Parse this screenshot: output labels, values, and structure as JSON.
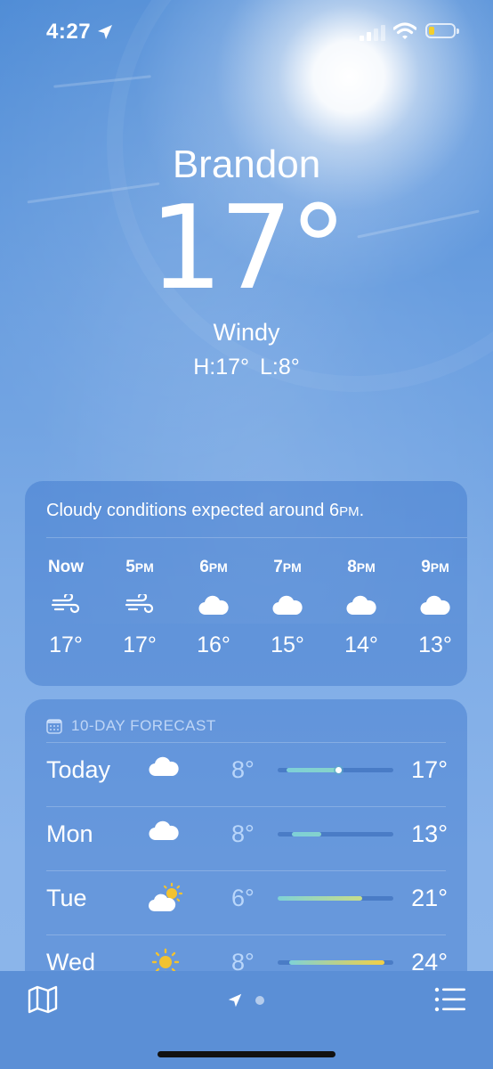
{
  "status_bar": {
    "time": "4:27"
  },
  "header": {
    "city": "Brandon",
    "temperature": "17°",
    "condition": "Windy",
    "high": "H:17°",
    "low": "L:8°"
  },
  "hourly": {
    "summary_lead": "Cloudy conditions expected around 6",
    "summary_suffix": "PM",
    "summary_end": ".",
    "hours": [
      {
        "label": "Now",
        "suffix": "",
        "icon": "wind-icon",
        "temp": "17°"
      },
      {
        "label": "5",
        "suffix": "PM",
        "icon": "wind-icon",
        "temp": "17°"
      },
      {
        "label": "6",
        "suffix": "PM",
        "icon": "cloud-icon",
        "temp": "16°"
      },
      {
        "label": "7",
        "suffix": "PM",
        "icon": "cloud-icon",
        "temp": "15°"
      },
      {
        "label": "8",
        "suffix": "PM",
        "icon": "cloud-icon",
        "temp": "14°"
      },
      {
        "label": "9",
        "suffix": "PM",
        "icon": "cloud-icon",
        "temp": "13°"
      }
    ]
  },
  "forecast": {
    "title": "10-DAY FORECAST",
    "days": [
      {
        "day": "Today",
        "icon": "cloud-icon",
        "low": "8°",
        "high": "17°",
        "range_start": 0.08,
        "range_end": 0.52,
        "current": 0.52,
        "gradient": [
          "#7ed0d8",
          "#86d4c8"
        ]
      },
      {
        "day": "Mon",
        "icon": "cloud-icon",
        "low": "8°",
        "high": "13°",
        "range_start": 0.12,
        "range_end": 0.37,
        "gradient": [
          "#7ed0d8",
          "#84d2cc"
        ]
      },
      {
        "day": "Tue",
        "icon": "partly-sunny-icon",
        "low": "6°",
        "high": "21°",
        "range_start": 0.0,
        "range_end": 0.73,
        "gradient": [
          "#7fd2d6",
          "#c7dd8a"
        ]
      },
      {
        "day": "Wed",
        "icon": "sun-icon",
        "low": "8°",
        "high": "24°",
        "range_start": 0.1,
        "range_end": 0.92,
        "gradient": [
          "#7fd2d6",
          "#f2cf45"
        ]
      }
    ]
  }
}
